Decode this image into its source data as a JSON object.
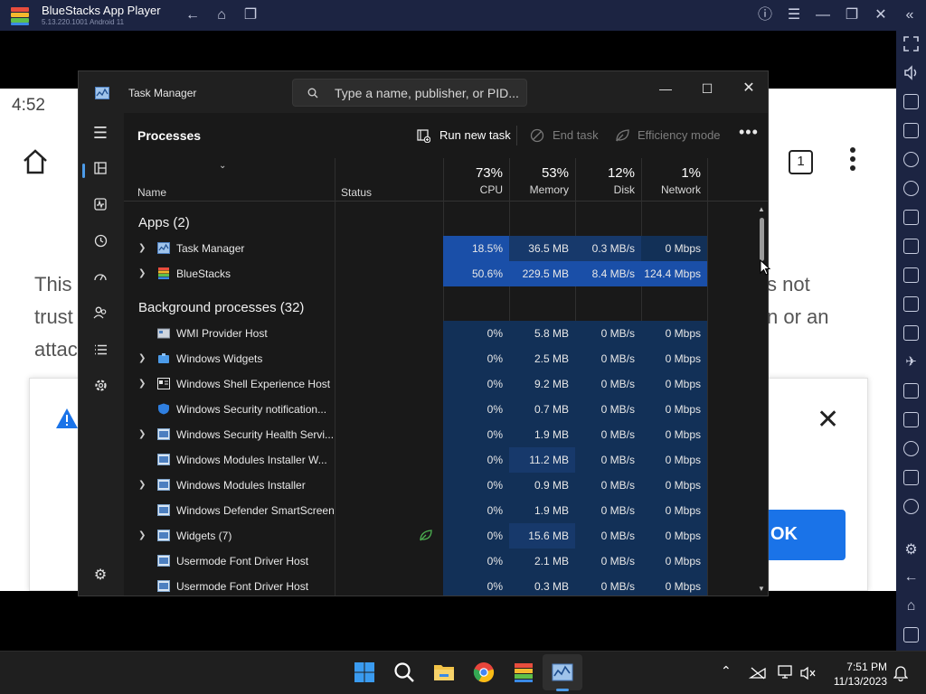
{
  "bluestacks": {
    "title": "BlueStacks App Player",
    "version": "5.13.220.1001  Android 11"
  },
  "android": {
    "time": "4:52",
    "bg_text_left": [
      "This",
      "trust",
      "attac"
    ],
    "bg_text_right": [
      "s not",
      "n or an"
    ],
    "tab_count": "1",
    "ok_label": "OK"
  },
  "taskmanager": {
    "title": "Task Manager",
    "search_placeholder": "Type a name, publisher, or PID...",
    "heading": "Processes",
    "run_new_task": "Run new task",
    "end_task": "End task",
    "efficiency_mode": "Efficiency mode",
    "columns": {
      "name": "Name",
      "status": "Status",
      "cpu_pct": "73%",
      "cpu": "CPU",
      "mem_pct": "53%",
      "mem": "Memory",
      "disk_pct": "12%",
      "disk": "Disk",
      "net_pct": "1%",
      "net": "Network"
    },
    "apps_header": "Apps (2)",
    "bg_header": "Background processes (32)",
    "apps": [
      {
        "name": "Task Manager",
        "cpu": "18.5%",
        "mem": "36.5 MB",
        "disk": "0.3 MB/s",
        "net": "0 Mbps"
      },
      {
        "name": "BlueStacks",
        "cpu": "50.6%",
        "mem": "229.5 MB",
        "disk": "8.4 MB/s",
        "net": "124.4 Mbps"
      }
    ],
    "background": [
      {
        "name": "WMI Provider Host",
        "cpu": "0%",
        "mem": "5.8 MB",
        "disk": "0 MB/s",
        "net": "0 Mbps"
      },
      {
        "name": "Windows Widgets",
        "cpu": "0%",
        "mem": "2.5 MB",
        "disk": "0 MB/s",
        "net": "0 Mbps"
      },
      {
        "name": "Windows Shell Experience Host",
        "cpu": "0%",
        "mem": "9.2 MB",
        "disk": "0 MB/s",
        "net": "0 Mbps"
      },
      {
        "name": "Windows Security notification...",
        "cpu": "0%",
        "mem": "0.7 MB",
        "disk": "0 MB/s",
        "net": "0 Mbps"
      },
      {
        "name": "Windows Security Health Servi...",
        "cpu": "0%",
        "mem": "1.9 MB",
        "disk": "0 MB/s",
        "net": "0 Mbps"
      },
      {
        "name": "Windows Modules Installer W...",
        "cpu": "0%",
        "mem": "11.2 MB",
        "disk": "0 MB/s",
        "net": "0 Mbps"
      },
      {
        "name": "Windows Modules Installer",
        "cpu": "0%",
        "mem": "0.9 MB",
        "disk": "0 MB/s",
        "net": "0 Mbps"
      },
      {
        "name": "Windows Defender SmartScreen",
        "cpu": "0%",
        "mem": "1.9 MB",
        "disk": "0 MB/s",
        "net": "0 Mbps"
      },
      {
        "name": "Widgets (7)",
        "cpu": "0%",
        "mem": "15.6 MB",
        "disk": "0 MB/s",
        "net": "0 Mbps"
      },
      {
        "name": "Usermode Font Driver Host",
        "cpu": "0%",
        "mem": "2.1 MB",
        "disk": "0 MB/s",
        "net": "0 Mbps"
      },
      {
        "name": "Usermode Font Driver Host",
        "cpu": "0%",
        "mem": "0.3 MB",
        "disk": "0 MB/s",
        "net": "0 Mbps"
      }
    ]
  },
  "taskbar": {
    "time": "7:51 PM",
    "date": "11/13/2023"
  },
  "colors": {
    "heat_high": "#1a4fa8",
    "heat_low": "#123057",
    "heat_mid": "#17396b",
    "accent": "#4c9be8"
  }
}
